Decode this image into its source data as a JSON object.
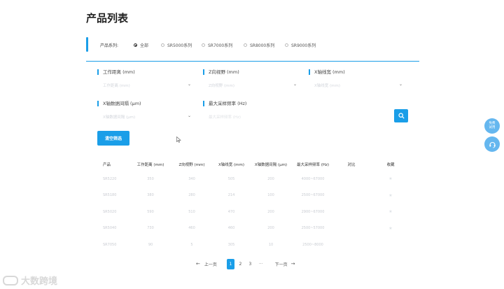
{
  "page_title": "产品列表",
  "series": {
    "label": "产品系列:",
    "options": [
      {
        "label": "全部",
        "checked": true
      },
      {
        "label": "SR5000系列",
        "checked": false
      },
      {
        "label": "SR7000系列",
        "checked": false
      },
      {
        "label": "SR8000系列",
        "checked": false
      },
      {
        "label": "SR9000系列",
        "checked": false
      }
    ]
  },
  "filters": {
    "working_distance": {
      "label": "工作距离 (mm)",
      "placeholder": "工作距离 (mm)"
    },
    "z_range": {
      "label": "Z向视野 (mm)",
      "placeholder": "Z向视野 (mm)"
    },
    "x_width": {
      "label": "X轴线宽 (mm)",
      "placeholder": "X轴线宽 (mm)"
    },
    "x_interval": {
      "label": "X轴数据间隔 (μm)",
      "placeholder": "X轴数据间隔 (μm)"
    },
    "max_freq": {
      "label": "最大采样频率 (Hz)",
      "placeholder_min": "最大采样频率 (Hz)",
      "placeholder_max": ""
    }
  },
  "clear_button": "清空筛选",
  "float_buttons": {
    "quote_line1": "免费",
    "quote_line2": "试用"
  },
  "table": {
    "headers": [
      "产品",
      "工作距离 (mm)",
      "Z向视野 (mm)",
      "X轴线宽 (mm)",
      "X轴数据间隔 (μm)",
      "最大采样频率 (Hz)",
      "对比",
      "收藏"
    ],
    "rows": [
      [
        "SR5220",
        "350",
        "340",
        "505",
        "200",
        "4000~67000"
      ],
      [
        "SR5180",
        "380",
        "280",
        "214",
        "100",
        "2500~67000"
      ],
      [
        "SR5020",
        "590",
        "510",
        "470",
        "200",
        "2900~67000"
      ],
      [
        "SR5040",
        "730",
        "460",
        "460",
        "200",
        "2500~57000"
      ],
      [
        "SR7050",
        "90",
        "5",
        "305",
        "10",
        "2500~8000"
      ]
    ]
  },
  "pagination": {
    "prev": "上一页",
    "pages": [
      "1",
      "2",
      "3"
    ],
    "active": "1",
    "ellipsis": "···",
    "next": "下一页"
  },
  "watermark": "大数跨境",
  "colors": {
    "accent": "#1a9ee8",
    "float": "#65b7ef"
  }
}
